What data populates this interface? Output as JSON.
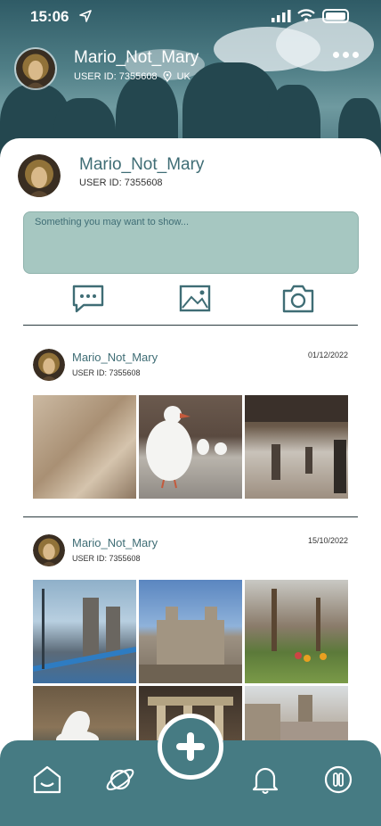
{
  "status_bar": {
    "time": "15:06",
    "location_icon": "location-arrow-icon",
    "signal_icon": "cellular-signal-icon",
    "wifi_icon": "wifi-icon",
    "battery_icon": "battery-icon"
  },
  "header": {
    "name": "Mario_Not_Mary",
    "user_id": "USER ID: 7355608",
    "location": "UK",
    "location_icon": "map-pin-icon",
    "more_icon": "more-dots-icon"
  },
  "profile": {
    "name": "Mario_Not_Mary",
    "user_id": "USER ID: 7355608"
  },
  "composer": {
    "placeholder": "Something you may want to show...",
    "actions": [
      {
        "name": "text-post",
        "icon": "chat-bubble-icon"
      },
      {
        "name": "image-post",
        "icon": "image-icon"
      },
      {
        "name": "camera-post",
        "icon": "camera-icon"
      }
    ]
  },
  "posts": [
    {
      "name": "Mario_Not_Mary",
      "user_id": "USER ID: 7355608",
      "date": "01/12/2022",
      "photos": [
        "stone-relief",
        "seagulls",
        "railway-station"
      ]
    },
    {
      "name": "Mario_Not_Mary",
      "user_id": "USER ID: 7355608",
      "date": "15/10/2022",
      "photos": [
        "tower-bridge",
        "tower-of-london",
        "park-picnic",
        "swan",
        "ruins-columns",
        "castle-walls"
      ]
    }
  ],
  "bottom_nav": {
    "items": [
      {
        "name": "home",
        "icon": "home-icon"
      },
      {
        "name": "explore",
        "icon": "planet-icon"
      },
      {
        "name": "notifications",
        "icon": "bell-icon"
      },
      {
        "name": "settings",
        "icon": "toggle-icon"
      }
    ],
    "add_icon": "plus-icon"
  },
  "colors": {
    "accent": "#467b83",
    "name_text": "#3f6d75",
    "composer_bg": "#a6c7c1"
  }
}
